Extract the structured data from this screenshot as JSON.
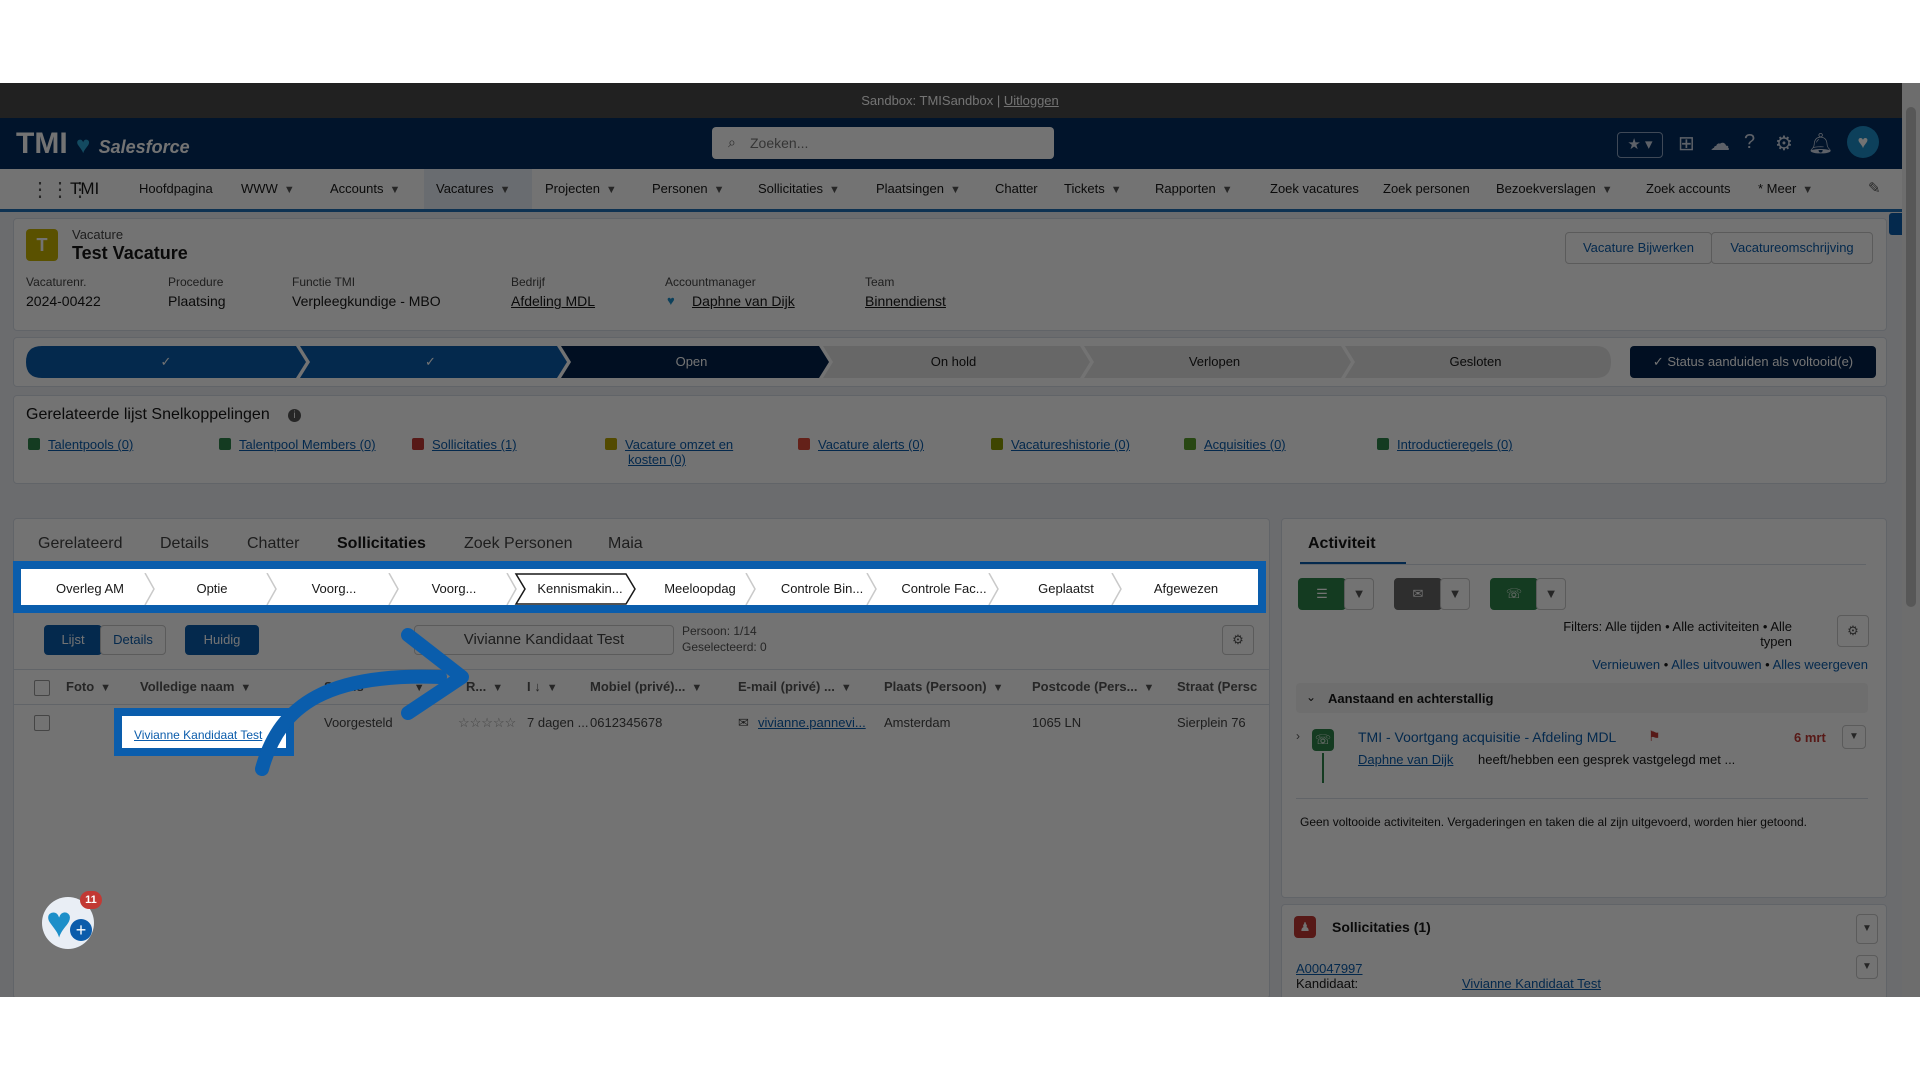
{
  "sandbox": {
    "text": "Sandbox: TMISandbox |",
    "logout": "Uitloggen"
  },
  "header": {
    "logo_text": "TMI",
    "logo_sub": "Salesforce",
    "search_placeholder": "Zoeken..."
  },
  "nav": {
    "app_name": "TMI",
    "items": [
      {
        "label": "Hoofdpagina"
      },
      {
        "label": "WWW"
      },
      {
        "label": "Accounts"
      },
      {
        "label": "Vacatures"
      },
      {
        "label": "Projecten"
      },
      {
        "label": "Personen"
      },
      {
        "label": "Sollicitaties"
      },
      {
        "label": "Plaatsingen"
      },
      {
        "label": "Chatter"
      },
      {
        "label": "Tickets"
      },
      {
        "label": "Rapporten"
      },
      {
        "label": "Zoek vacatures"
      },
      {
        "label": "Zoek personen"
      },
      {
        "label": "Bezoekverslagen"
      },
      {
        "label": "Zoek accounts"
      },
      {
        "label": "* Meer"
      }
    ]
  },
  "record": {
    "object_label": "Vacature",
    "title": "Test Vacature",
    "buttons": {
      "update": "Vacature Bijwerken",
      "description": "Vacatureomschrijving"
    },
    "fields": [
      {
        "label": "Vacaturenr.",
        "value": "2024-00422"
      },
      {
        "label": "Procedure",
        "value": "Plaatsing"
      },
      {
        "label": "Functie TMI",
        "value": "Verpleegkundige - MBO"
      },
      {
        "label": "Bedrijf",
        "value": "Afdeling MDL"
      },
      {
        "label": "Accountmanager",
        "value": "Daphne van Dijk"
      },
      {
        "label": "Team",
        "value": "Binnendienst"
      }
    ]
  },
  "path": {
    "stages": [
      {
        "label": "✓"
      },
      {
        "label": "✓"
      },
      {
        "label": "Open"
      },
      {
        "label": "On hold"
      },
      {
        "label": "Verlopen"
      },
      {
        "label": "Gesloten"
      }
    ],
    "complete_button": "Status aanduiden als voltooid(e)"
  },
  "quicklinks": {
    "title": "Gerelateerde lijst Snelkoppelingen",
    "items": [
      {
        "label": "Talentpools (0)",
        "color": "#2e844a"
      },
      {
        "label": "Talentpool Members (0)",
        "color": "#2e844a"
      },
      {
        "label": "Sollicitaties (1)",
        "color": "#c23934"
      },
      {
        "label": "Vacature omzet en",
        "label2": "kosten (0)",
        "color": "#b8a400"
      },
      {
        "label": "Vacature alerts (0)",
        "color": "#dd4b39"
      },
      {
        "label": "Vacatureshistorie (0)",
        "color": "#8a9a00"
      },
      {
        "label": "Acquisities (0)",
        "color": "#5a9e2a"
      },
      {
        "label": "Introductieregels (0)",
        "color": "#2e844a"
      }
    ]
  },
  "tabs": {
    "items": [
      {
        "label": "Gerelateerd"
      },
      {
        "label": "Details"
      },
      {
        "label": "Chatter"
      },
      {
        "label": "Sollicitaties"
      },
      {
        "label": "Zoek Personen"
      },
      {
        "label": "Maia"
      }
    ]
  },
  "stages": {
    "items": [
      {
        "label": "Overleg AM"
      },
      {
        "label": "Optie"
      },
      {
        "label": "Voorg..."
      },
      {
        "label": "Voorg..."
      },
      {
        "label": "Kennismakin..."
      },
      {
        "label": "Meeloopdag"
      },
      {
        "label": "Controle Bin..."
      },
      {
        "label": "Controle Fac..."
      },
      {
        "label": "Geplaatst"
      },
      {
        "label": "Afgewezen"
      }
    ]
  },
  "subtoolbar": {
    "lijst": "Lijst",
    "details": "Details",
    "huidig": "Huidig",
    "candidate": "Vivianne Kandidaat Test",
    "person_count": "Persoon: 1/14",
    "selected": "Geselecteerd: 0"
  },
  "table": {
    "headers": [
      "Foto",
      "Volledige naam",
      "Status",
      "R...",
      "I",
      "Mobiel (privé)...",
      "E-mail (privé) ...",
      "Plaats (Persoon)",
      "Postcode (Pers...",
      "Straat (Persc"
    ],
    "row": {
      "name": "Vivianne Kandidaat Test",
      "status": "Voorgesteld",
      "rating": "☆☆☆☆☆",
      "days": "7 dagen ...",
      "mobile": "0612345678",
      "email": "vivianne.pannevi...",
      "city": "Amsterdam",
      "postcode": "1065 LN",
      "street": "Sierplein 76"
    }
  },
  "activity": {
    "title": "Activiteit",
    "filters": "Filters: Alle tijden • Alle activiteiten • Alle typen",
    "actions": [
      "Vernieuwen",
      "Alles uitvouwen",
      "Alles weergeven"
    ],
    "section": "Aanstaand en achterstallig",
    "item_title": "TMI - Voortgang acquisitie - Afdeling MDL",
    "item_date": "6 mrt",
    "item_user": "Daphne van Dijk",
    "item_text": "heeft/hebben een gesprek vastgelegd met ...",
    "empty": "Geen voltooide activiteiten. Vergaderingen en taken die al zijn uitgevoerd, worden hier getoond."
  },
  "sollicitaties_card": {
    "title": "Sollicitaties (1)",
    "record_id": "A00047997",
    "label": "Kandidaat:",
    "value": "Vivianne Kandidaat Test"
  },
  "utility": {
    "badge": "11"
  },
  "colors": {
    "brand_navy": "#032d60",
    "path_blue": "#0b5cab",
    "path_dark": "#03234d",
    "highlight": "#0a5dac"
  }
}
